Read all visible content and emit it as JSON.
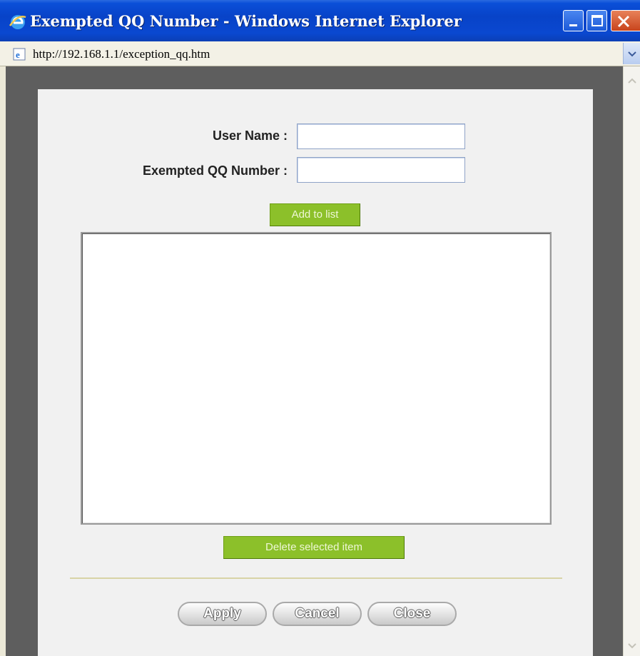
{
  "window": {
    "title": "Exempted QQ Number - Windows Internet Explorer",
    "url": "http://192.168.1.1/exception_qq.htm"
  },
  "form": {
    "user_name_label": "User Name :",
    "user_name_value": "",
    "qq_label": "Exempted QQ Number :",
    "qq_value": ""
  },
  "buttons": {
    "add_to_list": "Add to list",
    "delete_selected": "Delete selected item",
    "apply": "Apply",
    "cancel": "Cancel",
    "close": "Close"
  },
  "list": {
    "items": []
  },
  "colors": {
    "titlebar": "#0843c8",
    "green_button": "#8cc02a",
    "panel_bg": "#f1f1f1",
    "viewport_bg": "#5e5e5e"
  },
  "icons": {
    "window": "internet-explorer-icon",
    "page": "ie-page-icon",
    "minimize": "minimize-icon",
    "maximize": "maximize-icon",
    "close": "close-icon"
  }
}
